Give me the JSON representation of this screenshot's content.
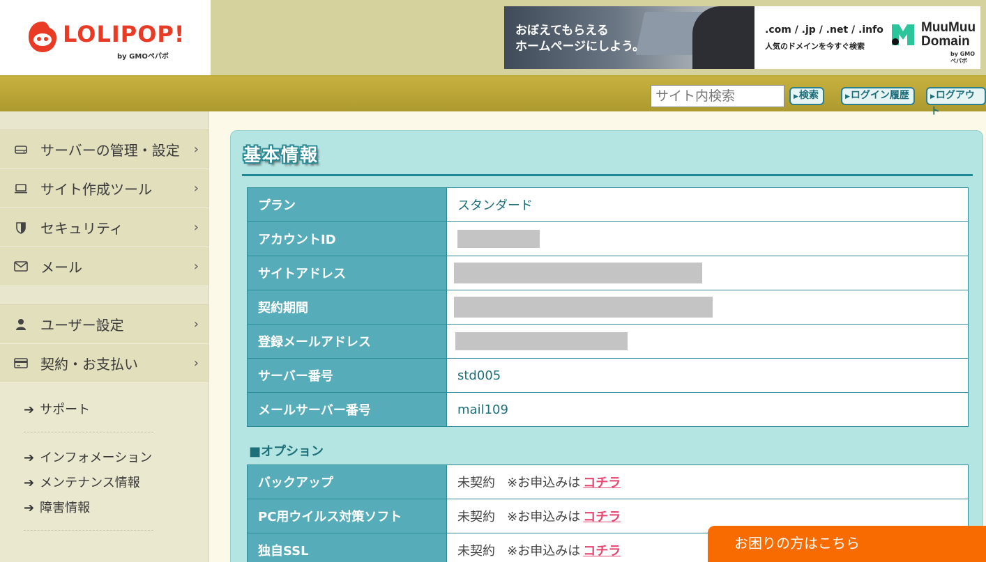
{
  "header": {
    "logo_text": "LOLIPOP!",
    "logo_sub": "by GMOペパボ",
    "banner": {
      "copy_line1": "おぼえてもらえる",
      "copy_line2": "ホームページにしよう。",
      "domains": ".com / .jp / .net / .info",
      "tagline": "人気のドメインを今すぐ検索",
      "brand_line1": "MuuMuu",
      "brand_line2": "Domain",
      "brand_sub": "by GMOペパボ"
    }
  },
  "toolbar": {
    "search_placeholder": "サイト内検索",
    "search_button": "検索",
    "login_history_button": "ログイン履歴",
    "logout_button": "ログアウト"
  },
  "sidebar": {
    "items": [
      {
        "label": "サーバーの管理・設定",
        "icon": "server-icon"
      },
      {
        "label": "サイト作成ツール",
        "icon": "laptop-icon"
      },
      {
        "label": "セキュリティ",
        "icon": "shield-icon"
      },
      {
        "label": "メール",
        "icon": "mail-icon"
      },
      {
        "label": "ユーザー設定",
        "icon": "user-icon"
      },
      {
        "label": "契約・お支払い",
        "icon": "credit-card-icon"
      }
    ],
    "links": [
      "サポート",
      "インフォメーション",
      "メンテナンス情報",
      "障害情報"
    ]
  },
  "main": {
    "title": "基本情報",
    "rows": [
      {
        "label": "プラン",
        "value": "スタンダード"
      },
      {
        "label": "アカウントID",
        "value": ""
      },
      {
        "label": "サイトアドレス",
        "value": ""
      },
      {
        "label": "契約期間",
        "value": ""
      },
      {
        "label": "登録メールアドレス",
        "value": ""
      },
      {
        "label": "サーバー番号",
        "value": "std005"
      },
      {
        "label": "メールサーバー番号",
        "value": "mail109"
      }
    ],
    "options_heading": "■オプション",
    "options": [
      {
        "label": "バックアップ",
        "status": "未契約",
        "note": "※お申込みは",
        "link": "コチラ"
      },
      {
        "label": "PC用ウイルス対策ソフト",
        "status": "未契約",
        "note": "※お申込みは",
        "link": "コチラ"
      },
      {
        "label": "独自SSL",
        "status": "未契約",
        "note": "※お申込みは",
        "link": "コチラ"
      }
    ]
  },
  "help_button": "お困りの方はこちら",
  "colors": {
    "brand_red": "#e83a25",
    "panel_bg": "#b4e5e3",
    "table_header": "#57acb9",
    "link_pink": "#e5466f",
    "help_orange": "#f76b00"
  }
}
